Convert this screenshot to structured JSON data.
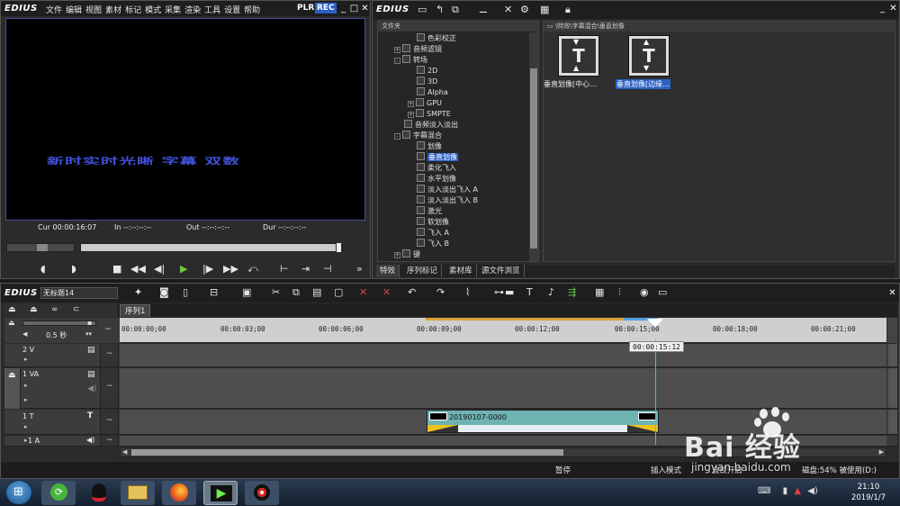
{
  "player": {
    "logo": "EDIUS",
    "menu": [
      "文件",
      "编辑",
      "视图",
      "素材",
      "标记",
      "模式",
      "采集",
      "渲染",
      "工具",
      "设置",
      "帮助"
    ],
    "plr": "PLR",
    "rec": "REC",
    "preview_text": "新时实时光晰 字幕 双数",
    "timecodes": [
      {
        "label": "Cur",
        "value": "00:00:16:07"
      },
      {
        "label": "In",
        "value": "--:--:--:--"
      },
      {
        "label": "Out",
        "value": "--:--:--:--"
      },
      {
        "label": "Dur",
        "value": "--:--:--:--"
      }
    ]
  },
  "effects": {
    "logo": "EDIUS",
    "folder_header": "文件夹",
    "path": "\\特效\\字幕混合\\垂直划像",
    "tree": [
      {
        "label": "色彩校正",
        "indent": 3,
        "expander": ""
      },
      {
        "label": "音频滤镜",
        "indent": 2,
        "expander": "+"
      },
      {
        "label": "转场",
        "indent": 1,
        "expander": "-"
      },
      {
        "label": "2D",
        "indent": 3,
        "expander": ""
      },
      {
        "label": "3D",
        "indent": 3,
        "expander": ""
      },
      {
        "label": "Alpha",
        "indent": 3,
        "expander": ""
      },
      {
        "label": "GPU",
        "indent": 3,
        "expander": "+"
      },
      {
        "label": "SMPTE",
        "indent": 3,
        "expander": "+"
      },
      {
        "label": "音频淡入淡出",
        "indent": 2,
        "expander": ""
      },
      {
        "label": "字幕混合",
        "indent": 1,
        "expander": "-"
      },
      {
        "label": "划像",
        "indent": 3,
        "expander": ""
      },
      {
        "label": "垂直划像",
        "indent": 3,
        "expander": "",
        "selected": true
      },
      {
        "label": "柔化飞入",
        "indent": 3,
        "expander": ""
      },
      {
        "label": "水平划像",
        "indent": 3,
        "expander": ""
      },
      {
        "label": "淡入淡出飞入 A",
        "indent": 3,
        "expander": ""
      },
      {
        "label": "淡入淡出飞入 B",
        "indent": 3,
        "expander": ""
      },
      {
        "label": "激光",
        "indent": 3,
        "expander": ""
      },
      {
        "label": "软划像",
        "indent": 3,
        "expander": ""
      },
      {
        "label": "飞入 A",
        "indent": 3,
        "expander": ""
      },
      {
        "label": "飞入 B",
        "indent": 3,
        "expander": ""
      },
      {
        "label": "键",
        "indent": 1,
        "expander": "+"
      }
    ],
    "items": [
      {
        "label": "垂直划像[中心…",
        "selected": false
      },
      {
        "label": "垂直划像[边缘…",
        "selected": true
      }
    ],
    "tabs": [
      "特效",
      "序列标记",
      "素材库",
      "源文件浏览"
    ]
  },
  "timeline": {
    "logo": "EDIUS",
    "project_name": "无标题14",
    "sequence_tab": "序列1",
    "scale": "0.5 秒",
    "ruler_ticks": [
      "00:00:00;00",
      "00:00:03;00",
      "00:00:06;00",
      "00:00:09;00",
      "00:00:12;00",
      "00:00:15;00",
      "00:00:18;00",
      "00:00:21;00"
    ],
    "cursor_time": "00:00:15:12",
    "tracks": [
      {
        "label": "2 V"
      },
      {
        "label": "1 VA"
      },
      {
        "label": "1 T"
      },
      {
        "label": "1 A"
      }
    ],
    "clip_name": "20190107-0000",
    "status": {
      "pause": "暂停",
      "insert_mode": "插入模式",
      "ripple": "波纹开启",
      "disk": "磁盘:54% 被使用(D:)"
    }
  },
  "taskbar": {
    "time": "21:10",
    "date": "2019/1/7"
  },
  "watermark": {
    "text": "Bai 经验",
    "url": "jingyan.baidu.com"
  }
}
